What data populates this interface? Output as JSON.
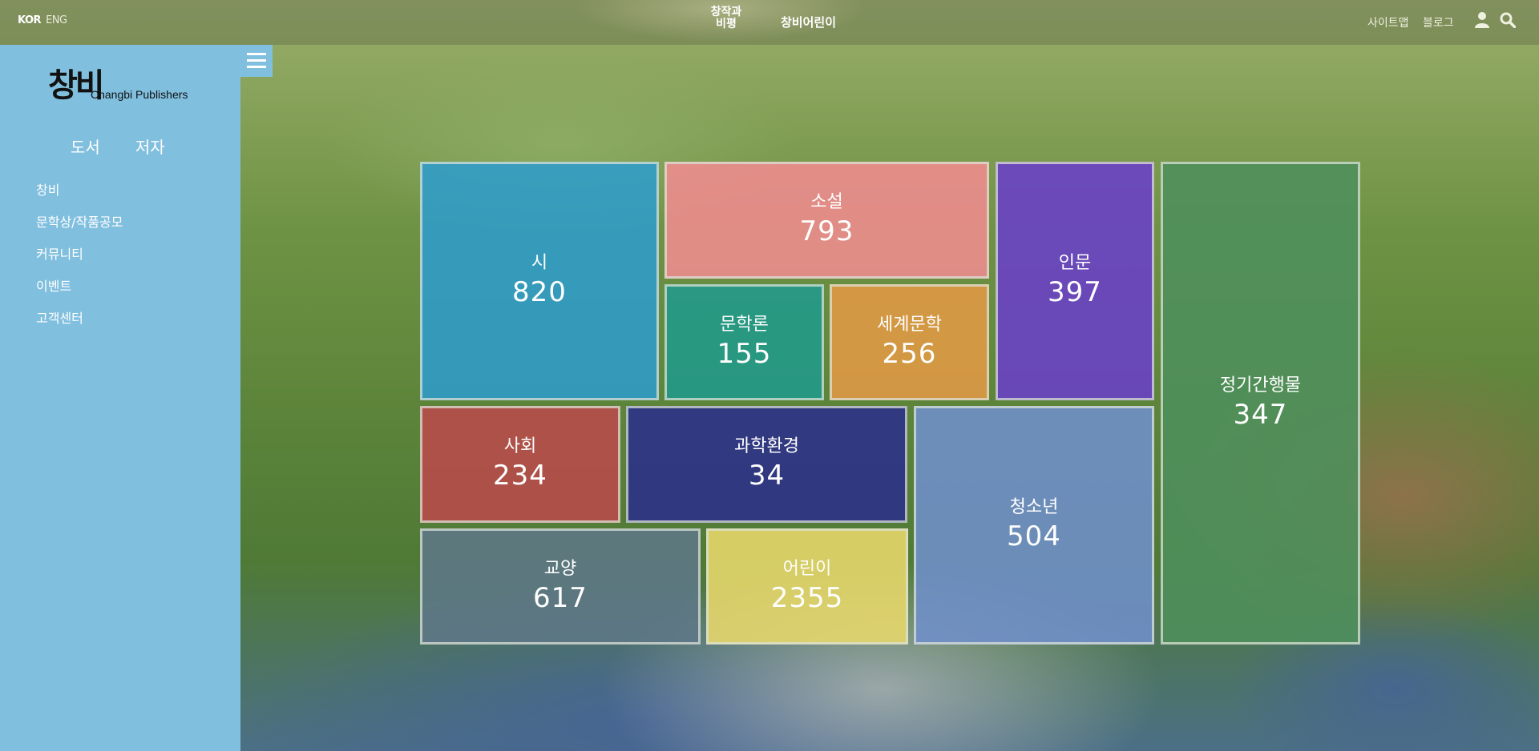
{
  "header": {
    "lang_kor": "KOR",
    "lang_eng": "ENG",
    "brand_a_line1": "창작과",
    "brand_a_line2": "비평",
    "brand_b": "창비어린이",
    "sitemap": "사이트맵",
    "blog": "블로그"
  },
  "sidebar": {
    "logo_ko": "창비",
    "logo_en": "Changbi Publishers",
    "tabs": [
      {
        "label": "도서"
      },
      {
        "label": "저자"
      }
    ],
    "items": [
      {
        "label": "창비"
      },
      {
        "label": "문학상/작품공모"
      },
      {
        "label": "커뮤니티"
      },
      {
        "label": "이벤트"
      },
      {
        "label": "고객센터"
      }
    ]
  },
  "categories": [
    {
      "name": "시",
      "count": "820",
      "color": "#2f9ccb"
    },
    {
      "name": "소설",
      "count": "793",
      "color": "#f08c90"
    },
    {
      "name": "인문",
      "count": "397",
      "color": "#6a3fc8"
    },
    {
      "name": "정기간행물",
      "count": "347",
      "color": "#4e8f5c"
    },
    {
      "name": "문학론",
      "count": "155",
      "color": "#219a8b"
    },
    {
      "name": "세계문학",
      "count": "256",
      "color": "#e39a45"
    },
    {
      "name": "사회",
      "count": "234",
      "color": "#b94a4a"
    },
    {
      "name": "과학환경",
      "count": "34",
      "color": "#2b2f8a"
    },
    {
      "name": "청소년",
      "count": "504",
      "color": "#6f8fcb"
    },
    {
      "name": "교양",
      "count": "617",
      "color": "#5f7888"
    },
    {
      "name": "어린이",
      "count": "2355",
      "color": "#e8d86c"
    }
  ]
}
